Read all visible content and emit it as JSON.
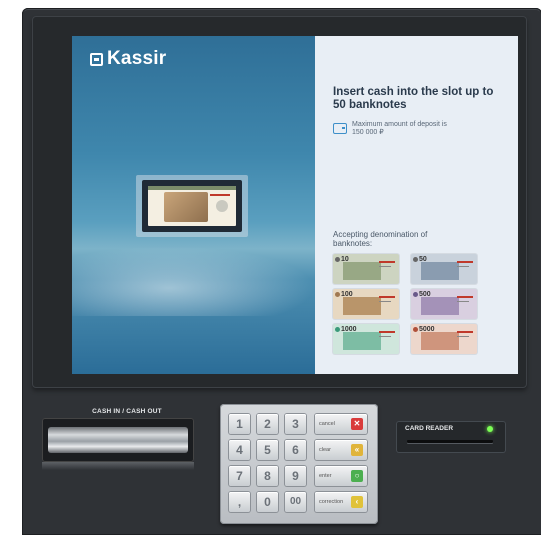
{
  "screen": {
    "brand": "Kassir",
    "headline": "Insert cash into the slot up to 50 banknotes",
    "max_deposit": "Maximum amount of deposit is 150 000 ₽",
    "accepting_label": "Accepting denomination of banknotes:",
    "banknotes": [
      {
        "label": "10",
        "color": "#cdd4c1"
      },
      {
        "label": "50",
        "color": "#c9d2dc"
      },
      {
        "label": "100",
        "color": "#e7d8c1"
      },
      {
        "label": "500",
        "color": "#d9cfe0"
      },
      {
        "label": "1000",
        "color": "#cfe6dc"
      },
      {
        "label": "5000",
        "color": "#edd7cc"
      }
    ]
  },
  "hardware": {
    "cash_label": "CASH IN / CASH OUT",
    "card_label": "CARD READER"
  },
  "keypad": {
    "keys": [
      "1",
      "2",
      "3",
      "4",
      "5",
      "6",
      "7",
      "8",
      "9",
      ",",
      "0",
      "00"
    ],
    "functions": [
      {
        "label": "cancel",
        "icon": "✕",
        "icon_name": "cancel-icon",
        "color": "#d93b3b"
      },
      {
        "label": "clear",
        "icon": "«",
        "icon_name": "clear-icon",
        "color": "#e0b43a"
      },
      {
        "label": "enter",
        "icon": "○",
        "icon_name": "enter-icon",
        "color": "#4caf50"
      },
      {
        "label": "correction",
        "icon": "‹",
        "icon_name": "correction-icon",
        "color": "#e0c23a"
      }
    ]
  }
}
